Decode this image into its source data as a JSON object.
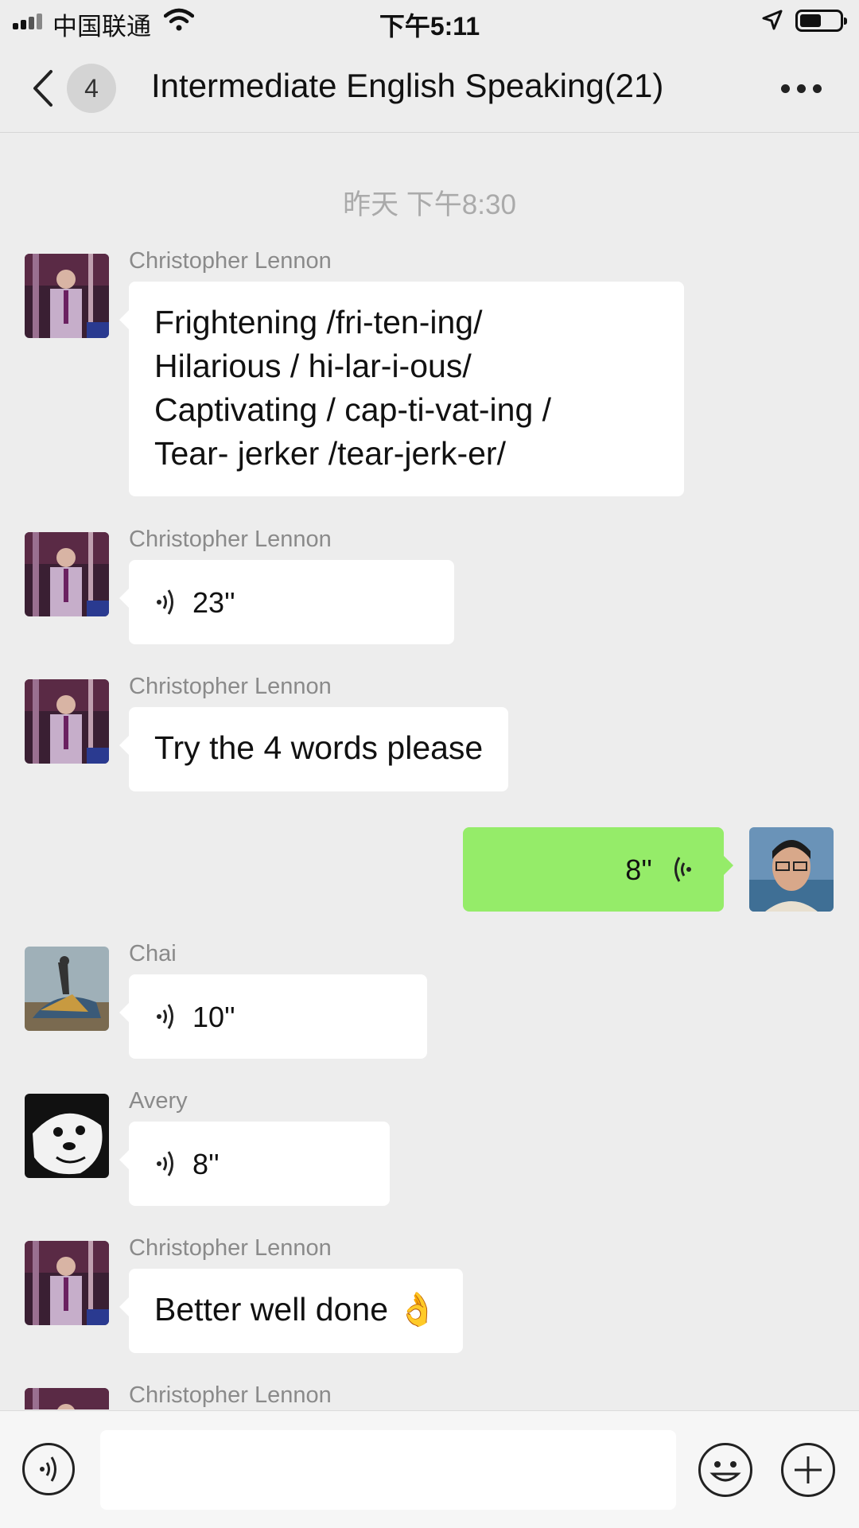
{
  "status_bar": {
    "carrier": "中国联通",
    "time": "下午5:11"
  },
  "nav": {
    "unread_count": "4",
    "title": "Intermediate English Speaking(21)"
  },
  "chat": {
    "timestamp": "昨天 下午8:30",
    "messages": [
      {
        "sender": "Christopher Lennon",
        "type": "text",
        "text": "Frightening /fri-ten-ing/\nHilarious / hi-lar-i-ous/\nCaptivating / cap-ti-vat-ing /\nTear- jerker /tear-jerk-er/"
      },
      {
        "sender": "Christopher Lennon",
        "type": "voice",
        "duration": "23''"
      },
      {
        "sender": "Christopher Lennon",
        "type": "text",
        "text": "Try the 4 words please"
      },
      {
        "sender": "",
        "type": "voice",
        "duration": "8''",
        "outgoing": true
      },
      {
        "sender": "Chai",
        "type": "voice",
        "duration": "10''"
      },
      {
        "sender": "Avery",
        "type": "voice",
        "duration": "8''"
      },
      {
        "sender": "Christopher Lennon",
        "type": "text",
        "text": "Better well done 👌"
      },
      {
        "sender": "Christopher Lennon",
        "type": "text",
        "text": ""
      }
    ]
  },
  "colors": {
    "background": "#ededed",
    "outgoing_bubble": "#95ec69",
    "incoming_bubble": "#ffffff",
    "sender_name": "#8a8a8a"
  },
  "icons": {
    "back": "chevron-left-icon",
    "more": "more-dots-icon",
    "voice_input": "voice-input-icon",
    "emoji": "emoji-icon",
    "plus": "plus-icon"
  }
}
